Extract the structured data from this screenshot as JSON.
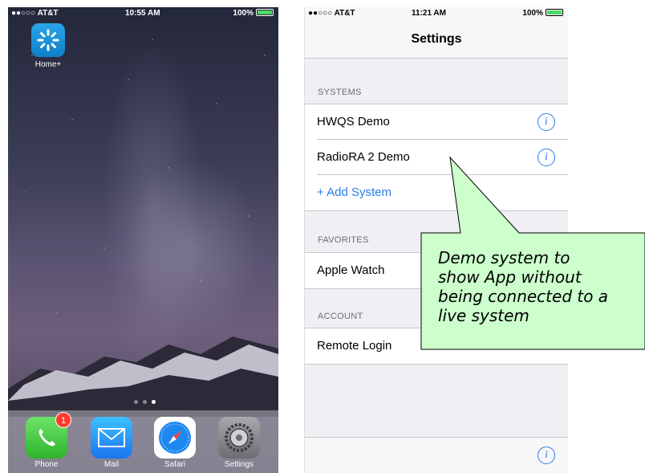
{
  "home": {
    "status": {
      "carrier": "●●○○○ AT&T",
      "time": "10:55 AM",
      "battery": "100%"
    },
    "apps": [
      {
        "label": "Home+",
        "icon": "lutron-home-plus-icon"
      }
    ],
    "dock": [
      {
        "label": "Phone",
        "icon": "phone-icon",
        "badge": "1"
      },
      {
        "label": "Mail",
        "icon": "mail-icon"
      },
      {
        "label": "Safari",
        "icon": "safari-compass-icon"
      },
      {
        "label": "Settings",
        "icon": "settings-gear-icon"
      }
    ],
    "page_dots": 3,
    "current_page": 3
  },
  "settings": {
    "status": {
      "carrier": "●●○○○ AT&T",
      "time": "11:21 AM",
      "battery": "100%"
    },
    "title": "Settings",
    "sections": [
      {
        "header": "SYSTEMS",
        "rows": [
          {
            "label": "HWQS Demo",
            "info": "i"
          },
          {
            "label": "RadioRA 2 Demo",
            "info": "i"
          },
          {
            "label": "+ Add System"
          }
        ]
      },
      {
        "header": "FAVORITES",
        "rows": [
          {
            "label": "Apple Watch"
          }
        ]
      },
      {
        "header": "ACCOUNT",
        "rows": [
          {
            "label": "Remote Login"
          }
        ]
      }
    ],
    "toolbar_info": "i"
  },
  "callout": {
    "lines": [
      "Demo system to",
      "show App without",
      "being connected to a",
      "live system"
    ],
    "fill": "#ccffcc"
  }
}
